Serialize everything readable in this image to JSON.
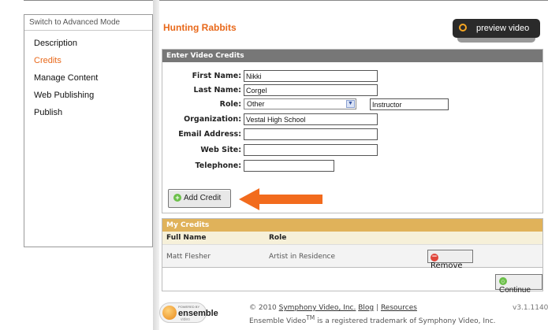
{
  "sidebar": {
    "mode_label": "Switch to Advanced Mode",
    "items": [
      {
        "label": "Description"
      },
      {
        "label": "Credits"
      },
      {
        "label": "Manage Content"
      },
      {
        "label": "Web Publishing"
      },
      {
        "label": "Publish"
      }
    ],
    "active_index": 1
  },
  "page": {
    "title": "Hunting Rabbits",
    "preview_label": "preview video"
  },
  "enter_credits": {
    "header": "Enter Video Credits",
    "first_name": {
      "label": "First Name:",
      "value": "Nikki"
    },
    "last_name": {
      "label": "Last Name:",
      "value": "Corgel"
    },
    "role": {
      "label": "Role:",
      "selected": "Other",
      "other_value": "Instructor"
    },
    "organization": {
      "label": "Organization:",
      "value": "Vestal High School"
    },
    "email": {
      "label": "Email Address:",
      "value": ""
    },
    "website": {
      "label": "Web Site:",
      "value": ""
    },
    "telephone": {
      "label": "Telephone:",
      "value": ""
    },
    "add_button": "Add Credit"
  },
  "my_credits": {
    "header": "My Credits",
    "columns": [
      "Full Name",
      "Role"
    ],
    "rows": [
      {
        "full_name": "Matt Flesher",
        "role": "Artist in Residence",
        "action": "Remove"
      }
    ]
  },
  "continue_label": "Continue",
  "footer": {
    "logo_powered": "POWERED BY",
    "logo_brand": "ensemble",
    "logo_sub": "video",
    "copyright": "© 2010",
    "company_link": "Symphony Video, Inc.",
    "blog_link": "Blog",
    "separator": "|",
    "resources_link": "Resources",
    "trademark_pre": "Ensemble Video",
    "trademark_sup": "TM",
    "trademark_post": " is a registered trademark of Symphony Video, Inc.",
    "version": "v3.1.1140"
  },
  "colors": {
    "accent": "#e8681a",
    "panel_header": "#777777",
    "credits_header": "#e0b25a",
    "arrow": "#f26b1d"
  }
}
